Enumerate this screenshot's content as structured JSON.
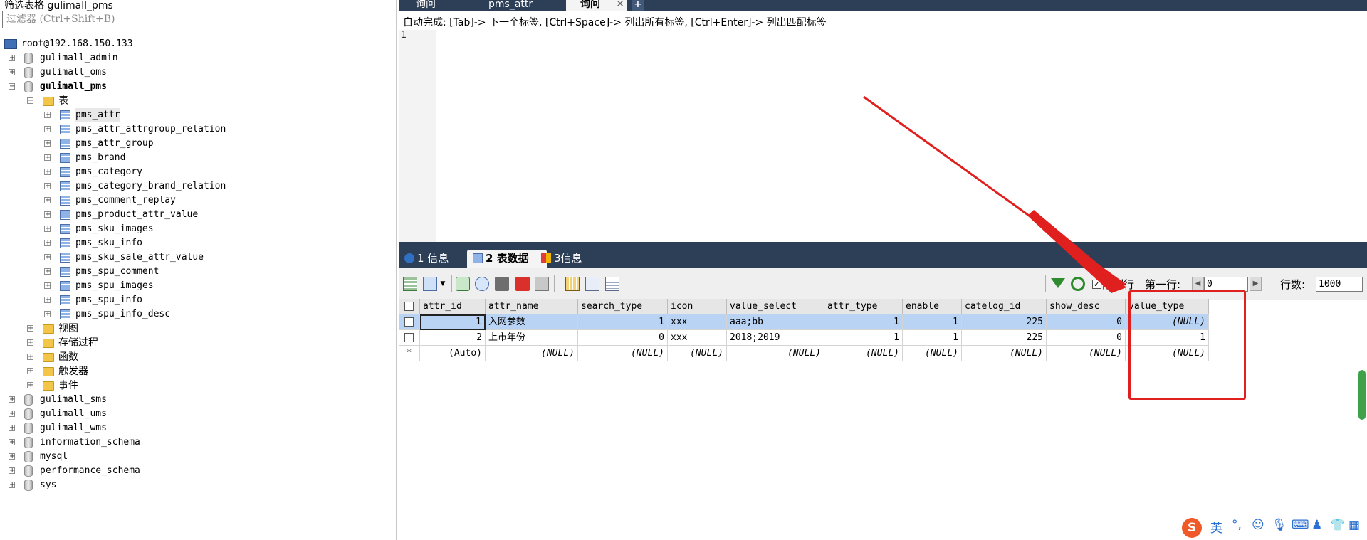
{
  "left_panel": {
    "title": "筛选表格 gulimall_pms",
    "filter_placeholder": "过滤器 (Ctrl+Shift+B)",
    "connection": "root@192.168.150.133",
    "databases_top": [
      "gulimall_admin",
      "gulimall_oms"
    ],
    "open_db": "gulimall_pms",
    "tables_folder": "表",
    "tables": [
      "pms_attr",
      "pms_attr_attrgroup_relation",
      "pms_attr_group",
      "pms_brand",
      "pms_category",
      "pms_category_brand_relation",
      "pms_comment_replay",
      "pms_product_attr_value",
      "pms_sku_images",
      "pms_sku_info",
      "pms_sku_sale_attr_value",
      "pms_spu_comment",
      "pms_spu_images",
      "pms_spu_info",
      "pms_spu_info_desc"
    ],
    "other_folders": [
      "视图",
      "存储过程",
      "函数",
      "触发器",
      "事件"
    ],
    "databases_bottom": [
      "gulimall_sms",
      "gulimall_ums",
      "gulimall_wms",
      "information_schema",
      "mysql",
      "performance_schema",
      "sys"
    ]
  },
  "query_tabs": [
    {
      "label": "询问",
      "active": false
    },
    {
      "label": "pms_attr",
      "active": false
    },
    {
      "label": "询问",
      "active": true,
      "close": "✕"
    }
  ],
  "add_tab": "+",
  "autocomplete_hint": "自动完成: [Tab]-> 下一个标签, [Ctrl+Space]-> 列出所有标签, [Ctrl+Enter]-> 列出匹配标签",
  "editor_line": "1",
  "result_tabs": [
    {
      "num": "1",
      "label": "信息",
      "active": false
    },
    {
      "num": "2",
      "label": "表数据",
      "active": true
    },
    {
      "num": "3",
      "label": "信息",
      "active": false
    }
  ],
  "toolbar": {
    "limit_label": "限制行",
    "first_row_label": "第一行:",
    "first_row_value": "0",
    "rows_label": "行数:",
    "rows_value": "1000"
  },
  "table": {
    "columns": [
      "attr_id",
      "attr_name",
      "search_type",
      "icon",
      "value_select",
      "attr_type",
      "enable",
      "catelog_id",
      "show_desc",
      "value_type"
    ],
    "rows": [
      [
        "1",
        "入网参数",
        "1",
        "xxx",
        "aaa;bb",
        "1",
        "1",
        "225",
        "0",
        "(NULL)"
      ],
      [
        "2",
        "上市年份",
        "0",
        "xxx",
        "2018;2019",
        "1",
        "1",
        "225",
        "0",
        "1"
      ],
      [
        "(Auto)",
        "(NULL)",
        "(NULL)",
        "(NULL)",
        "(NULL)",
        "(NULL)",
        "(NULL)",
        "(NULL)",
        "(NULL)",
        "(NULL)"
      ]
    ],
    "new_row_marker": "*"
  },
  "ime_bar": {
    "logo": "S",
    "lang": "英"
  },
  "colors": {
    "annotation_red": "#e0201e",
    "tab_dark": "#2d3e57",
    "selected_row": "#b8d3f4"
  }
}
